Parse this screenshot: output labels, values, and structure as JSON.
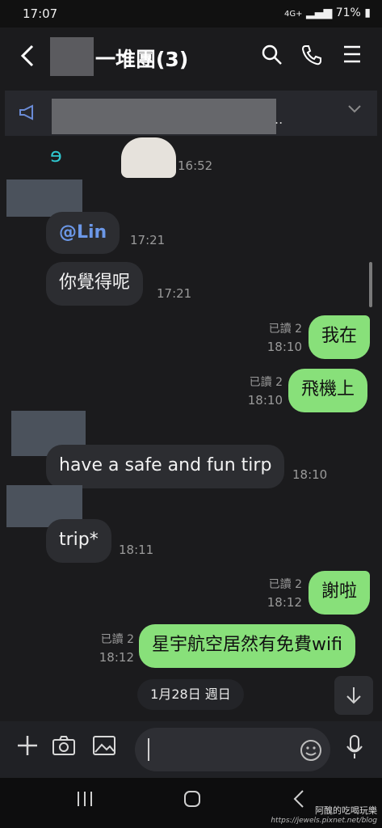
{
  "status_bar": {
    "time": "17:07",
    "battery": "71%",
    "network": "4G+"
  },
  "header": {
    "title": "一堆團(3)",
    "back_icon": "chevron-left-icon",
    "search_icon": "search-icon",
    "call_icon": "phone-icon",
    "menu_icon": "menu-icon"
  },
  "announcement": {
    "icon": "megaphone-icon",
    "ellipsis": "..",
    "expand_icon": "chevron-down-icon"
  },
  "messages": [
    {
      "time": "16:52"
    },
    {
      "mention": "@Lin",
      "time": "17:21"
    },
    {
      "text": "你覺得呢",
      "time": "17:21"
    },
    {
      "text": "我在",
      "read": "已讀 2",
      "time": "18:10"
    },
    {
      "text": "飛機上",
      "read": "已讀 2",
      "time": "18:10"
    },
    {
      "text": "have a safe and fun tirp",
      "time": "18:10"
    },
    {
      "text": "trip*",
      "time": "18:11"
    },
    {
      "text": "謝啦",
      "read": "已讀 2",
      "time": "18:12"
    },
    {
      "text": "星宇航空居然有免費wifi",
      "read": "已讀 2",
      "time": "18:12"
    }
  ],
  "date_separator": "1月28日 週日",
  "input_bar": {
    "plus_icon": "plus-icon",
    "camera_icon": "camera-icon",
    "image_icon": "image-icon",
    "emoji_icon": "emoji-icon",
    "mic_icon": "mic-icon"
  },
  "nav_bar": {
    "recents_icon": "recents-icon",
    "home_icon": "home-icon",
    "back_icon": "back-icon"
  },
  "watermark": {
    "line1": "阿醜的吃喝玩樂",
    "line2": "https://jewels.pixnet.net/blog"
  },
  "colors": {
    "outgoing": "#88e07a",
    "incoming": "#2c2d31",
    "background": "#1b1b1d",
    "mention": "#6c98e8"
  }
}
